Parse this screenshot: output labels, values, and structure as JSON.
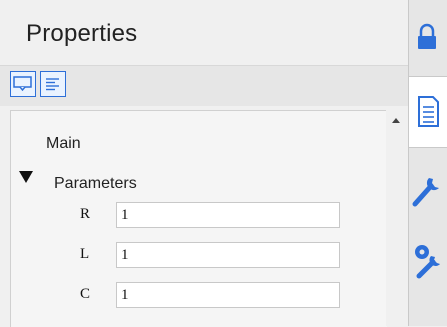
{
  "panel": {
    "title": "Properties",
    "toolbar": {
      "buttons": [
        {
          "icon": "comment-view-icon"
        },
        {
          "icon": "list-view-icon"
        }
      ]
    },
    "sections": [
      {
        "label": "Main"
      }
    ],
    "group": {
      "label": "Parameters",
      "expanded": true,
      "properties": [
        {
          "label": "R",
          "value": "1"
        },
        {
          "label": "L",
          "value": "1"
        },
        {
          "label": "C",
          "value": "1"
        }
      ]
    }
  },
  "side_tabs": [
    {
      "icon": "lock-icon",
      "active": false
    },
    {
      "icon": "document-icon",
      "active": true
    },
    {
      "icon": "wrench-icon",
      "active": false
    },
    {
      "icon": "tools-settings-icon",
      "active": false
    }
  ],
  "colors": {
    "accent": "#2d6fd8",
    "panel_bg": "#f0f0f0",
    "sidebar_bg": "#e6e6e6"
  }
}
